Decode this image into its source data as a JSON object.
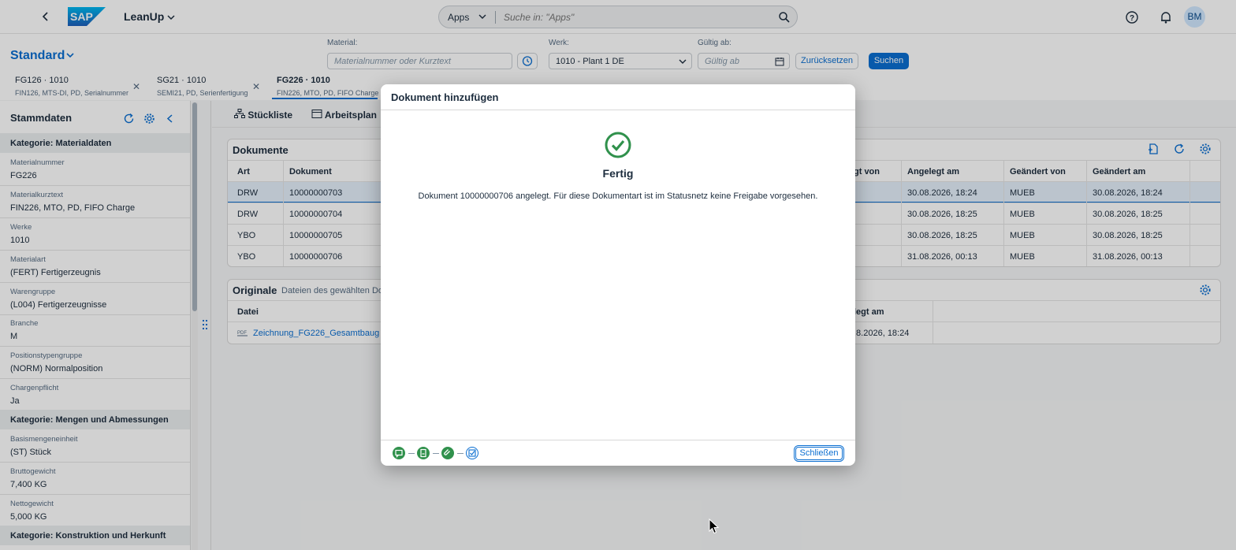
{
  "shell": {
    "app_name": "LeanUp",
    "search_scope": "Apps",
    "search_placeholder": "Suche in: \"Apps\"",
    "avatar_initials": "BM"
  },
  "filterbar": {
    "variant": "Standard",
    "material_label": "Material:",
    "material_placeholder": "Materialnummer oder Kurztext",
    "werk_label": "Werk:",
    "werk_value": "1010 - Plant 1 DE",
    "gueltig_label": "Gültig ab:",
    "gueltig_placeholder": "Gültig ab",
    "reset_label": "Zurücksetzen",
    "search_label": "Suchen"
  },
  "tabs": [
    {
      "title": "FG126 · 1010",
      "subtitle": "FIN126, MTS-DI, PD, Serialnummer"
    },
    {
      "title": "SG21 · 1010",
      "subtitle": "SEMI21, PD, Serienfertigung"
    },
    {
      "title": "FG226 · 1010",
      "subtitle": "FIN226, MTO, PD, FIFO Charge"
    }
  ],
  "sidebar": {
    "title": "Stammdaten",
    "cat1": "Kategorie: Materialdaten",
    "cat2": "Kategorie: Mengen und Abmessungen",
    "cat3": "Kategorie: Konstruktion und Herkunft",
    "fields": [
      {
        "label": "Materialnummer",
        "value": "FG226"
      },
      {
        "label": "Materialkurztext",
        "value": "FIN226, MTO, PD, FIFO Charge"
      },
      {
        "label": "Werke",
        "value": "1010"
      },
      {
        "label": "Materialart",
        "value": "(FERT) Fertigerzeugnis"
      },
      {
        "label": "Warengruppe",
        "value": "(L004) Fertigerzeugnisse"
      },
      {
        "label": "Branche",
        "value": "M"
      },
      {
        "label": "Positionstypengruppe",
        "value": "(NORM) Normalposition"
      },
      {
        "label": "Chargenpflicht",
        "value": "Ja"
      },
      {
        "label": "Basismengeneinheit",
        "value": "(ST) Stück"
      },
      {
        "label": "Bruttogewicht",
        "value": "7,400 KG"
      },
      {
        "label": "Nettogewicht",
        "value": "5,000 KG"
      }
    ]
  },
  "content": {
    "subtabs": [
      "Stückliste",
      "Arbeitsplan"
    ],
    "documents": {
      "title": "Dokumente",
      "headers": [
        "Art",
        "Dokument",
        "gt von",
        "Angelegt am",
        "Geändert von",
        "Geändert am"
      ],
      "rows": [
        {
          "art": "DRW",
          "doc": "10000000703",
          "created": "30.08.2026, 18:24",
          "changed_by": "MUEB",
          "changed": "30.08.2026, 18:24"
        },
        {
          "art": "DRW",
          "doc": "10000000704",
          "created": "30.08.2026, 18:25",
          "changed_by": "MUEB",
          "changed": "30.08.2026, 18:25"
        },
        {
          "art": "YBO",
          "doc": "10000000705",
          "created": "30.08.2026, 18:25",
          "changed_by": "MUEB",
          "changed": "30.08.2026, 18:25"
        },
        {
          "art": "YBO",
          "doc": "10000000706",
          "created": "31.08.2026, 00:13",
          "changed_by": "MUEB",
          "changed": "31.08.2026, 00:13"
        }
      ]
    },
    "originals": {
      "title": "Originale",
      "subtitle": "Dateien des gewählten Dok",
      "headers": [
        "Datei",
        "legt am"
      ],
      "file_name": "Zeichnung_FG226_Gesamtbaug",
      "file_date": ".8.2026, 18:24"
    }
  },
  "dialog": {
    "title": "Dokument hinzufügen",
    "status": "Fertig",
    "message": "Dokument 10000000706 angelegt. Für diese Dokumentart ist im Statusnetz keine Freigabe vorgesehen.",
    "close_label": "Schließen"
  },
  "colors": {
    "accent": "#0a6ed1",
    "success": "#30914c"
  }
}
